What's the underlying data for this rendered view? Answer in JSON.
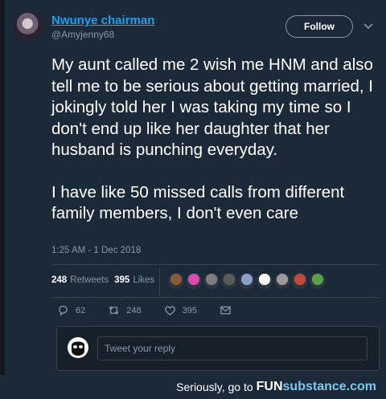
{
  "tweet": {
    "author_name": "Nwunye chairman",
    "handle": "@Amyjenny68",
    "follow_label": "Follow",
    "paragraphs": [
      "My aunt called me 2 wish me HNM and also tell me to be serious about getting married, I jokingly told her I was taking my time so I don't end up like her daughter that her husband is punching everyday.",
      "I have like 50 missed calls from different family members, I don't even care"
    ],
    "timestamp": "1:25 AM - 1 Dec 2018",
    "retweets_count": "248",
    "retweets_label": "Retweets",
    "likes_count": "395",
    "likes_label": "Likes",
    "liker_colors": [
      "#8a5a3c",
      "#d94ab0",
      "#7d7d7d",
      "#5a5a5a",
      "#8aa0c8",
      "#ffffff",
      "#9a9a9a",
      "#c04a3a",
      "#5aa04a"
    ],
    "actions": {
      "reply_count": "62",
      "retweet_count": "248",
      "like_count": "395"
    },
    "reply_placeholder": "Tweet your reply"
  },
  "footer": {
    "text": "Seriously, go to",
    "brand_fun": "FUN",
    "brand_rest": "substance",
    "brand_tld": ".com"
  },
  "colors": {
    "accent": "#1da1f2",
    "muted": "#8899a6",
    "background": "#1c2938"
  }
}
